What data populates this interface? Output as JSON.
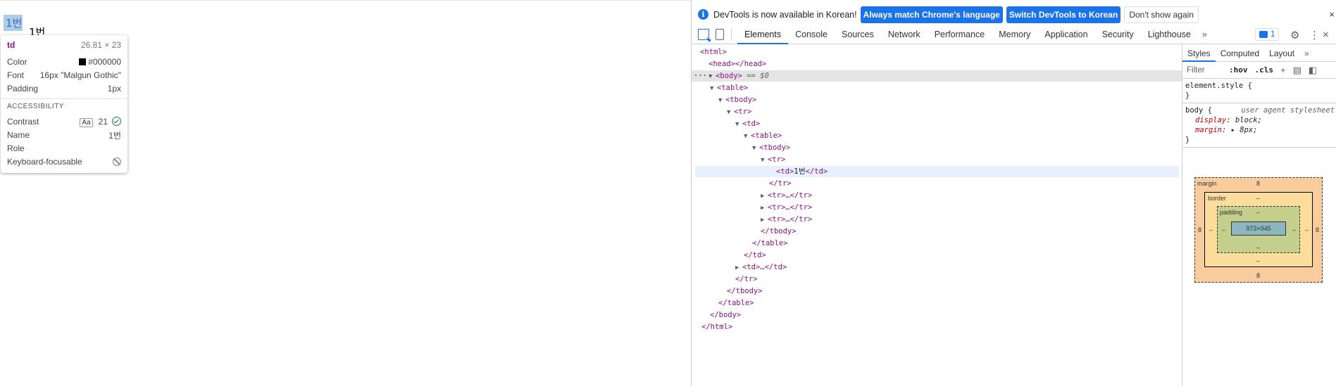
{
  "page": {
    "cell_1": "1번",
    "cell_2": "1번"
  },
  "tooltip": {
    "tag": "td",
    "size": "26.81 × 23",
    "color_label": "Color",
    "color_value": "#000000",
    "font_label": "Font",
    "font_value": "16px \"Malgun Gothic\"",
    "padding_label": "Padding",
    "padding_value": "1px",
    "accessibility_title": "ACCESSIBILITY",
    "contrast_label": "Contrast",
    "contrast_aa": "Aa",
    "contrast_value": "21",
    "name_label": "Name",
    "name_value": "1번",
    "role_label": "Role",
    "keyboard_label": "Keyboard-focusable"
  },
  "infobar": {
    "message": "DevTools is now available in Korean!",
    "btn_match": "Always match Chrome's language",
    "btn_switch": "Switch DevTools to Korean",
    "btn_dismiss": "Don't show again",
    "close": "×"
  },
  "tabs": [
    "Elements",
    "Console",
    "Sources",
    "Network",
    "Performance",
    "Memory",
    "Application",
    "Security",
    "Lighthouse"
  ],
  "tabbar": {
    "more": "»",
    "issues_count": "1",
    "gear": "⚙",
    "kebab": "⋮",
    "close": "×"
  },
  "tree": {
    "html_open": "<html>",
    "head": "<head></head>",
    "body_open": "<body>",
    "body_selected": " == $0",
    "table_open": "<table>",
    "tbody_open": "<tbody>",
    "tr_open": "<tr>",
    "td_open": "<td>",
    "inner_table_open": "<table>",
    "inner_tbody_open": "<tbody>",
    "inner_tr_open": "<tr>",
    "td_text_open": "<td>",
    "td_text": "1번",
    "td_text_close": "</td>",
    "tr_close_1": "</tr>",
    "tr_collapsed_1": "<tr>…</tr>",
    "tr_collapsed_2": "<tr>…</tr>",
    "tr_collapsed_3": "<tr>…</tr>",
    "inner_tbody_close": "</tbody>",
    "inner_table_close": "</table>",
    "td_close": "</td>",
    "td_collapsed": "<td>…</td>",
    "tr_close": "</tr>",
    "tbody_close": "</tbody>",
    "table_close": "</table>",
    "body_close": "</body>",
    "html_close": "</html>"
  },
  "sidepane": {
    "subtabs": [
      "Styles",
      "Computed",
      "Layout"
    ],
    "more": "»",
    "filter_placeholder": "Filter",
    "hov": ":hov",
    "cls": ".cls",
    "element_style_selector": "element.style {",
    "element_style_close": "}",
    "body_selector": "body {",
    "body_source": "user agent stylesheet",
    "prop_display": "display",
    "val_display": "block;",
    "prop_margin": "margin",
    "val_margin": "8px;",
    "body_close": "}"
  },
  "boxmodel": {
    "margin_label": "margin",
    "margin_top": "8",
    "margin_right": "8",
    "margin_bottom": "8",
    "margin_left": "8",
    "border_label": "border",
    "border_top": "–",
    "border_right": "–",
    "border_bottom": "–",
    "border_left": "–",
    "padding_label": "padding",
    "padding_top": "–",
    "padding_right": "–",
    "padding_bottom": "–",
    "padding_left": "–",
    "content": "973×945"
  },
  "colors": {
    "accent": "#1a73e8",
    "tag": "#881280",
    "prop": "#c80000"
  }
}
